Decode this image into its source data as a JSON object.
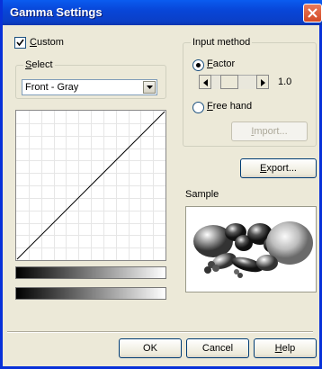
{
  "window": {
    "title": "Gamma Settings"
  },
  "custom_checkbox": {
    "label_underlined": "C",
    "label_rest": "ustom",
    "checked": true
  },
  "select_group": {
    "title_underlined": "S",
    "title_rest": "elect",
    "selected": "Front - Gray"
  },
  "input_method": {
    "title": "Input method",
    "factor": {
      "label_underlined": "F",
      "label_rest": "actor",
      "selected": true,
      "value": "1.0"
    },
    "freehand": {
      "label_underlined": "F",
      "label_rest": "ree hand",
      "selected": false
    },
    "import_label_underlined": "I",
    "import_label_rest": "mport..."
  },
  "export_button": {
    "label_underlined": "E",
    "label_rest": "xport..."
  },
  "sample": {
    "label": "Sample"
  },
  "buttons": {
    "ok": "OK",
    "cancel": "Cancel",
    "help_underlined": "H",
    "help_rest": "elp"
  }
}
